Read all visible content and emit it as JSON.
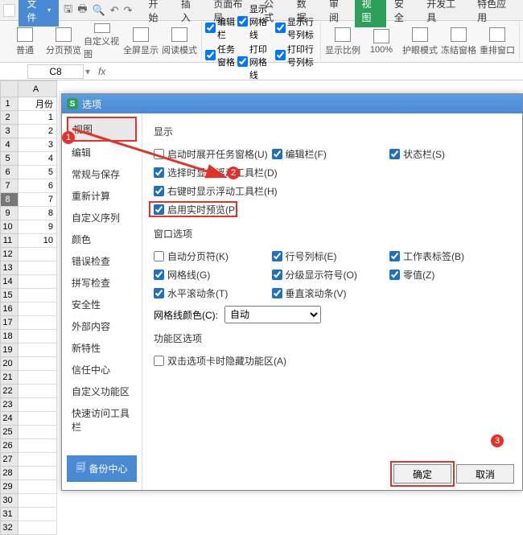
{
  "menubar": {
    "file": "文件",
    "tabs": [
      "开始",
      "插入",
      "页面布局",
      "公式",
      "数据",
      "审阅",
      "视图",
      "安全",
      "开发工具",
      "特色应用"
    ],
    "active_tab": 6
  },
  "ribbon": {
    "btns": [
      "普通",
      "分页预览",
      "自定义视图",
      "全屏显示",
      "阅读模式"
    ],
    "checks_col1": [
      "编辑栏",
      "任务窗格"
    ],
    "checks_col2": [
      "显示网格线",
      "打印网格线"
    ],
    "checks_col3": [
      "显示行号列标",
      "打印行号列标"
    ],
    "btns2": [
      "显示比例",
      "100%",
      "护眼模式",
      "冻结窗格",
      "重排窗口"
    ]
  },
  "refbar": {
    "cell": "C8",
    "fx": "fx"
  },
  "sheet": {
    "col": "A",
    "header_cell": "月份",
    "rows": [
      1,
      2,
      3,
      4,
      5,
      6,
      7,
      8,
      9,
      10
    ],
    "selected_row": 8
  },
  "dialog": {
    "title": "选项",
    "nav": [
      "视图",
      "编辑",
      "常规与保存",
      "重新计算",
      "自定义序列",
      "颜色",
      "错误检查",
      "拼写检查",
      "安全性",
      "外部内容",
      "新特性",
      "信任中心",
      "自定义功能区",
      "快速访问工具栏"
    ],
    "backup": "备份中心",
    "sections": {
      "display": "显示",
      "window": "窗口选项",
      "ribbon_area": "功能区选项"
    },
    "display_opts": [
      {
        "label": "启动时展开任务窗格(U)",
        "checked": false
      },
      {
        "label": "编辑栏(F)",
        "checked": true
      },
      {
        "label": "状态栏(S)",
        "checked": true
      },
      {
        "label": "选择时显示浮动工具栏(D)",
        "checked": true
      },
      {
        "label": "右键时显示浮动工具栏(H)",
        "checked": true
      },
      {
        "label": "启用实时预览(P)",
        "checked": true
      }
    ],
    "window_opts": [
      {
        "label": "自动分页符(K)",
        "checked": false
      },
      {
        "label": "行号列标(E)",
        "checked": true
      },
      {
        "label": "工作表标签(B)",
        "checked": true
      },
      {
        "label": "网格线(G)",
        "checked": true
      },
      {
        "label": "分级显示符号(O)",
        "checked": true
      },
      {
        "label": "零值(Z)",
        "checked": true
      },
      {
        "label": "水平滚动条(T)",
        "checked": true
      },
      {
        "label": "垂直滚动条(V)",
        "checked": true
      }
    ],
    "gridcolor_label": "网格线颜色(C):",
    "gridcolor_value": "自动",
    "ribbon_opt": {
      "label": "双击选项卡时隐藏功能区(A)",
      "checked": false
    },
    "ok": "确定",
    "cancel": "取消"
  },
  "badges": {
    "b1": "1",
    "b2": "2",
    "b3": "3"
  }
}
